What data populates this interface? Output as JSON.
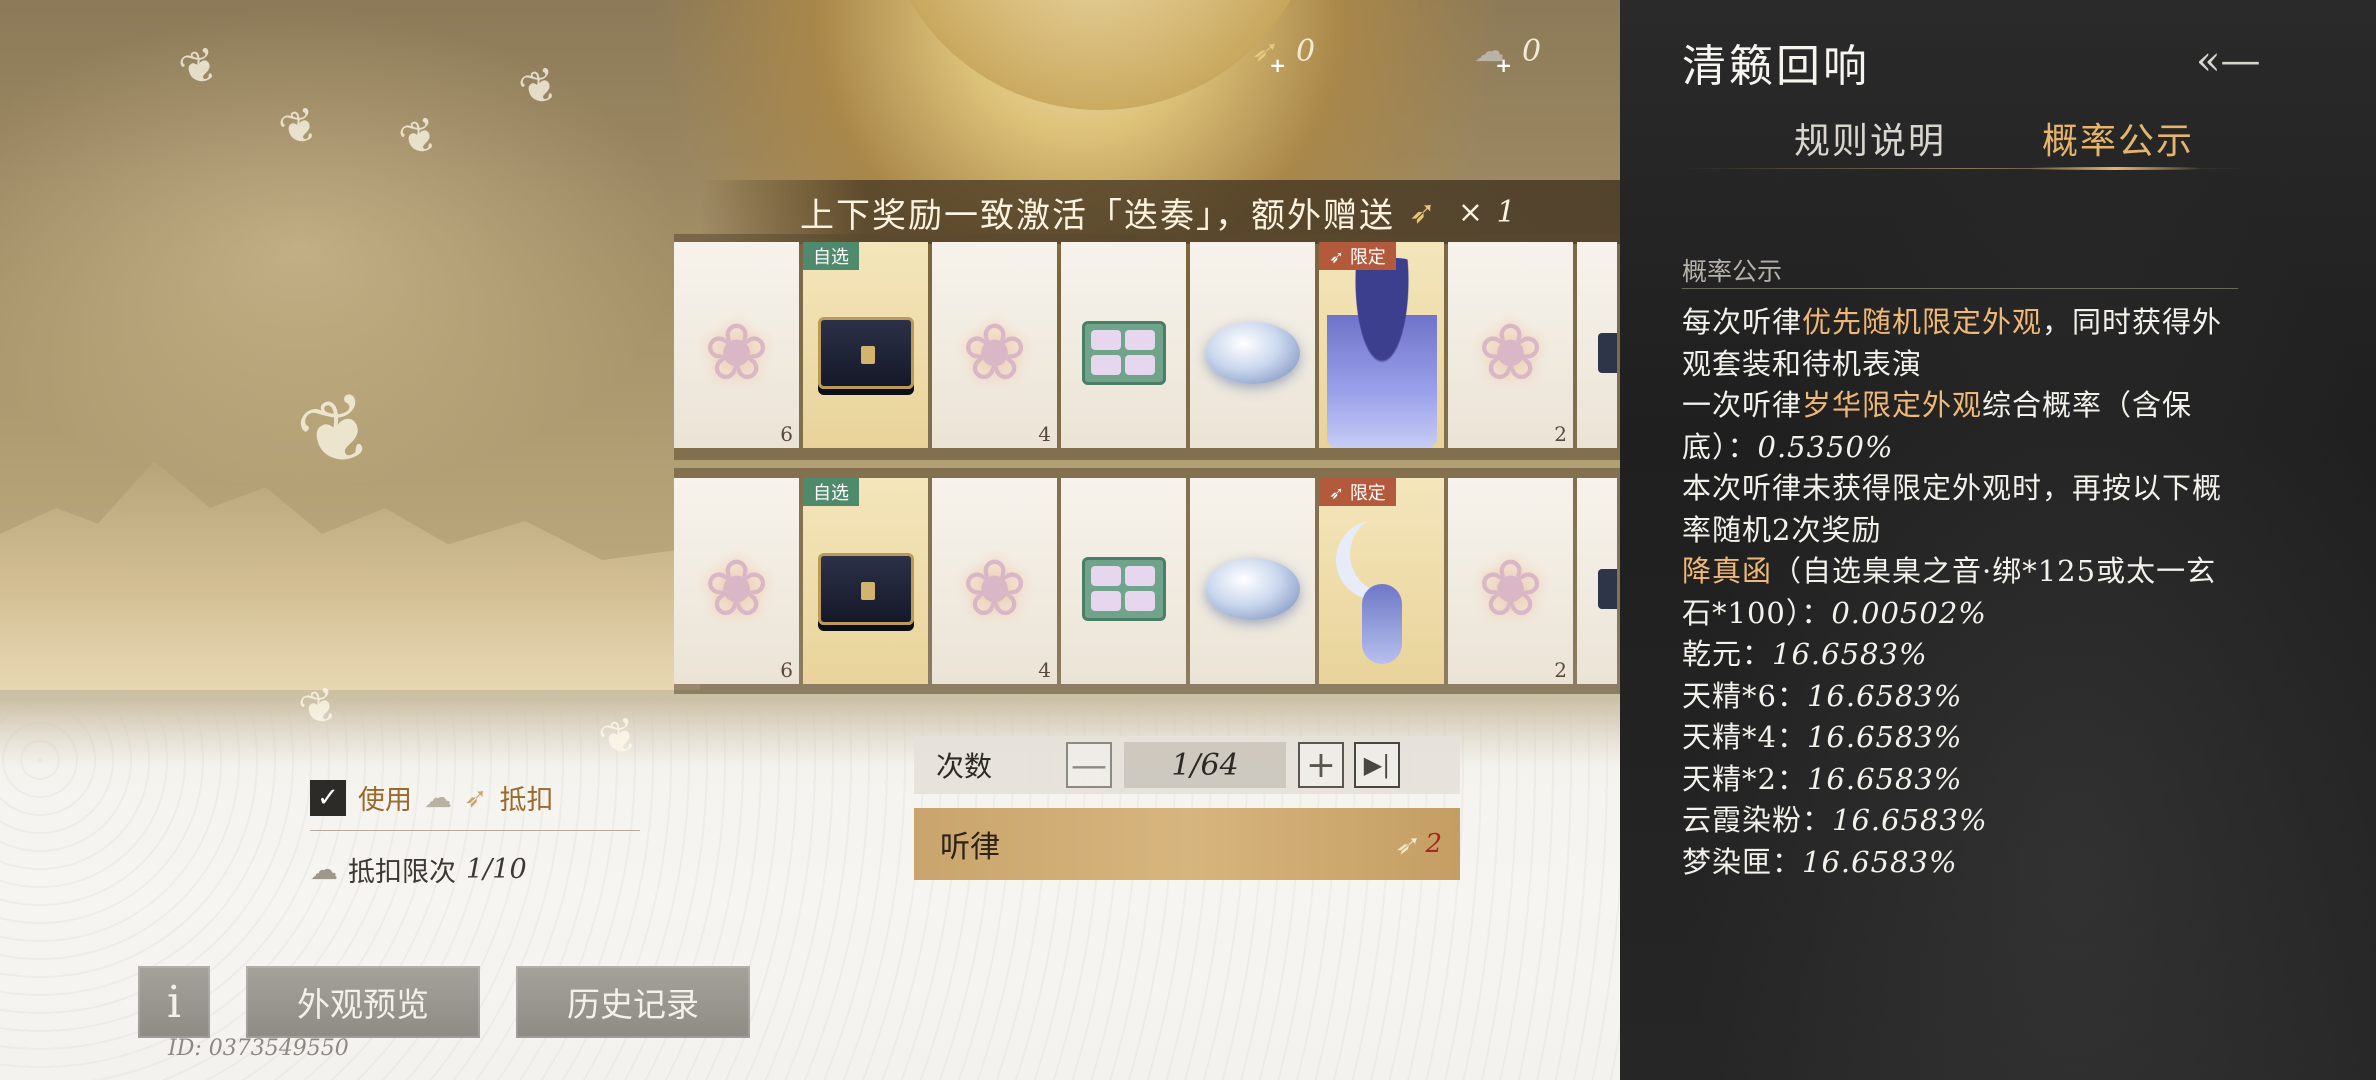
{
  "currencies": [
    {
      "icon": "swallow-token-icon",
      "value": "0"
    },
    {
      "icon": "cloud-token-icon",
      "value": "0"
    }
  ],
  "banner": {
    "text": "上下奖励一致激活「迭奏」，额外赠送",
    "multiplier": "× 1"
  },
  "reward_rows": [
    [
      {
        "item": "feather",
        "count": "6"
      },
      {
        "item": "chest",
        "tag": "自选"
      },
      {
        "item": "feather",
        "count": "4"
      },
      {
        "item": "tea-box"
      },
      {
        "item": "gem"
      },
      {
        "item": "costume-lady",
        "tag": "限定"
      },
      {
        "item": "feather",
        "count": "2"
      },
      {
        "item": "partial-item"
      }
    ],
    [
      {
        "item": "feather",
        "count": "6"
      },
      {
        "item": "chest",
        "tag": "自选"
      },
      {
        "item": "feather",
        "count": "4"
      },
      {
        "item": "tea-box"
      },
      {
        "item": "gem"
      },
      {
        "item": "costume-moon",
        "tag": "限定"
      },
      {
        "item": "feather",
        "count": "2"
      },
      {
        "item": "partial-item"
      }
    ]
  ],
  "counter": {
    "label": "次数",
    "minus": "—",
    "value": "1/64",
    "plus": "+",
    "max": "▶|"
  },
  "listen_button": {
    "label": "听律",
    "cost": "2"
  },
  "deduct": {
    "checked": true,
    "use_label": "使用",
    "deduct_label": "抵扣",
    "limit_label": "抵扣限次",
    "limit_value": "1/10"
  },
  "bottom_buttons": {
    "info": "i",
    "preview": "外观预览",
    "history": "历史记录"
  },
  "uid": "ID: 0373549550",
  "panel": {
    "title": "清籁回响",
    "tabs": [
      "规则说明",
      "概率公示"
    ],
    "active_tab": "概率公示",
    "section_label": "概率公示",
    "lines": {
      "l1a": "每次听律",
      "l1b": "优先随机限定外观",
      "l1c": "，同时获得外观套装和待机表演",
      "l2a": "一次听律",
      "l2b": "岁华限定外观",
      "l2c": "综合概率（含保底）：",
      "l2d": "0.5350%",
      "l3": "本次听律未获得限定外观时，再按以下概率随机2次奖励",
      "l4a": "降真函",
      "l4b": "（自选臬臬之音·绑*125或太一玄石*100）：",
      "l4c": "0.00502%",
      "items": [
        {
          "name": "乾元：",
          "rate": "16.6583%"
        },
        {
          "name": "天精*6：",
          "rate": "16.6583%"
        },
        {
          "name": "天精*4：",
          "rate": "16.6583%"
        },
        {
          "name": "天精*2：",
          "rate": "16.6583%"
        },
        {
          "name": "云霞染粉：",
          "rate": "16.6583%"
        },
        {
          "name": "梦染匣：",
          "rate": "16.6583%"
        }
      ]
    }
  },
  "colors": {
    "accent_gold": "#e5b46d",
    "highlight_orange": "#f0b876",
    "panel_bg": "#242424",
    "listen_button": "#d3b07a",
    "tag_green": "#4f8a6c",
    "tag_red": "#b45a3c"
  }
}
